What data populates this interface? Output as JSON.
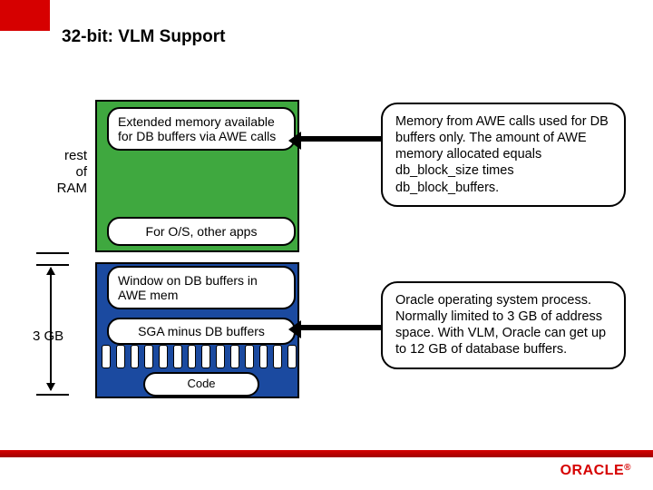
{
  "title": "32-bit: VLM Support",
  "leftLabels": {
    "restOfRam": "rest\nof\nRAM",
    "threeGB": "3 GB"
  },
  "stack": {
    "extended": "Extended memory available for DB buffers via AWE calls",
    "os": "For O/S, other apps",
    "window": "Window on DB buffers in AWE mem",
    "sga": "SGA minus DB buffers",
    "code": "Code"
  },
  "bubbles": {
    "awe": "Memory from AWE calls used for DB buffers only. The amount of AWE memory allocated equals db_block_size times db_block_buffers.",
    "process": "Oracle operating system process. Normally limited to 3 GB of address space. With VLM, Oracle can get up to 12 GB of database buffers."
  },
  "footer": {
    "brand": "ORACLE"
  }
}
